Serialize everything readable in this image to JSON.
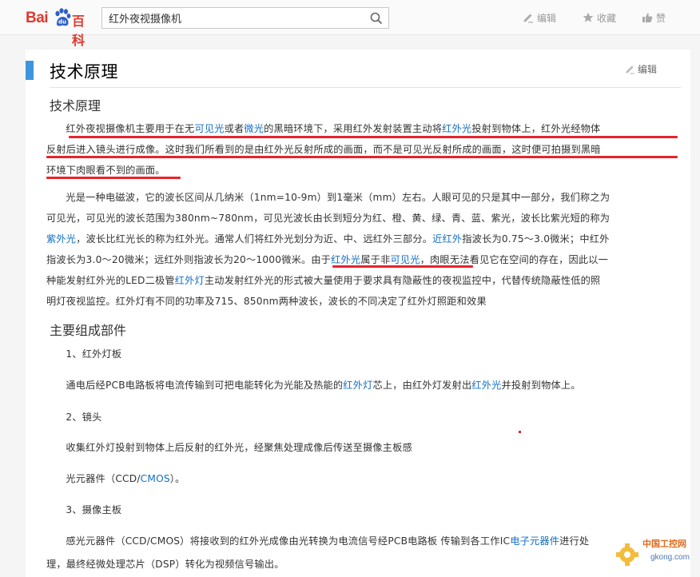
{
  "header": {
    "logo_bai": "Bai",
    "logo_baike": "百科",
    "search_value": "红外夜视摄像机",
    "actions": {
      "edit": "编辑",
      "favorite": "收藏",
      "like": "赞"
    }
  },
  "section": {
    "title": "技术原理",
    "edit": "编辑",
    "subtitle": "技术原理"
  },
  "p1": {
    "l1_a": "红外夜视摄像机主要用于在无",
    "l1_link1": "可见光",
    "l1_b": "或者",
    "l1_link2": "微光",
    "l1_c": "的黑暗环境下，采用红外发射装置主动将",
    "l1_link3": "红外光",
    "l1_d": "投射到物体上，红外光经物体",
    "l2": "反射后进入镜头进行成像。这时我们所看到的是由红外光反射所成的画面，而不是可见光反射所成的画面，这时便可拍摄到黑暗",
    "l3": "环境下肉眼看不到的画面。"
  },
  "p2": {
    "l1": "光是一种电磁波，它的波长区间从几纳米（1nm=10-9m）到1毫米（mm）左右。人眼可见的只是其中一部分，我们称之为",
    "l2": "可见光，可见光的波长范围为380nm~780nm，可见光波长由长到短分为红、橙、黄、绿、青、蓝、紫光，波长比紫光短的称为",
    "l3_link": "紫外光",
    "l3": "，波长比红光长的称为红外光。通常人们将红外光划分为近、中、远红外三部分。",
    "l3_link2": "近红外",
    "l3_b": "指波长为0.75～3.0微米；中红外",
    "l4_a": "指波长为3.0～20微米；远红外则指波长为20～1000微米。由于",
    "l4_link1": "红外光",
    "l4_b": "属于非",
    "l4_link2": "可见光",
    "l4_c": "，肉眼无法看见它在空间的存在，因此以一",
    "l5_a": "种能发射红外光的LED二极管",
    "l5_link": "红外灯",
    "l5_b": "主动发射红外光的形式被大量使用于要求具有隐蔽性的夜视监控中，代替传统隐蔽性低的照",
    "l6": "明灯夜视监控。红外灯有不同的功率及715、850nm两种波长，波长的不同决定了红外灯照距和效果"
  },
  "components": {
    "title": "主要组成部件",
    "item1_title": "1、红外灯板",
    "item1_a": "通电后经PCB电路板将电流传输到可把电能转化为光能及热能的",
    "item1_link1": "红外灯",
    "item1_b": "芯上，由红外灯发射出",
    "item1_link2": "红外光",
    "item1_c": "并投射到物体上。",
    "item2_title": "2、镜头",
    "item2_text": "收集红外灯投射到物体上后反射的红外光，经聚焦处理成像后传送至摄像主板感",
    "item2_b": "光元器件（CCD/",
    "item2_link": "CMOS",
    "item2_c": "）。",
    "item3_title": "3、摄像主板",
    "item3_a": "感光元器件（CCD/CMOS）将接收到的红外光成像由光转换为电流信号经PCB电路板 传输到各工作IC",
    "item3_link": "电子元器件",
    "item3_b": "进行处",
    "item3_c": "理，最终经微处理芯片（DSP）转化为视频信号输出。"
  },
  "watermark": {
    "cn": "中国工控网",
    "url": "gkong.com"
  },
  "colors": {
    "link": "#136ec2",
    "accent": "#3e95dd",
    "annotation": "#e8232c",
    "logo": "#de3a2f"
  }
}
